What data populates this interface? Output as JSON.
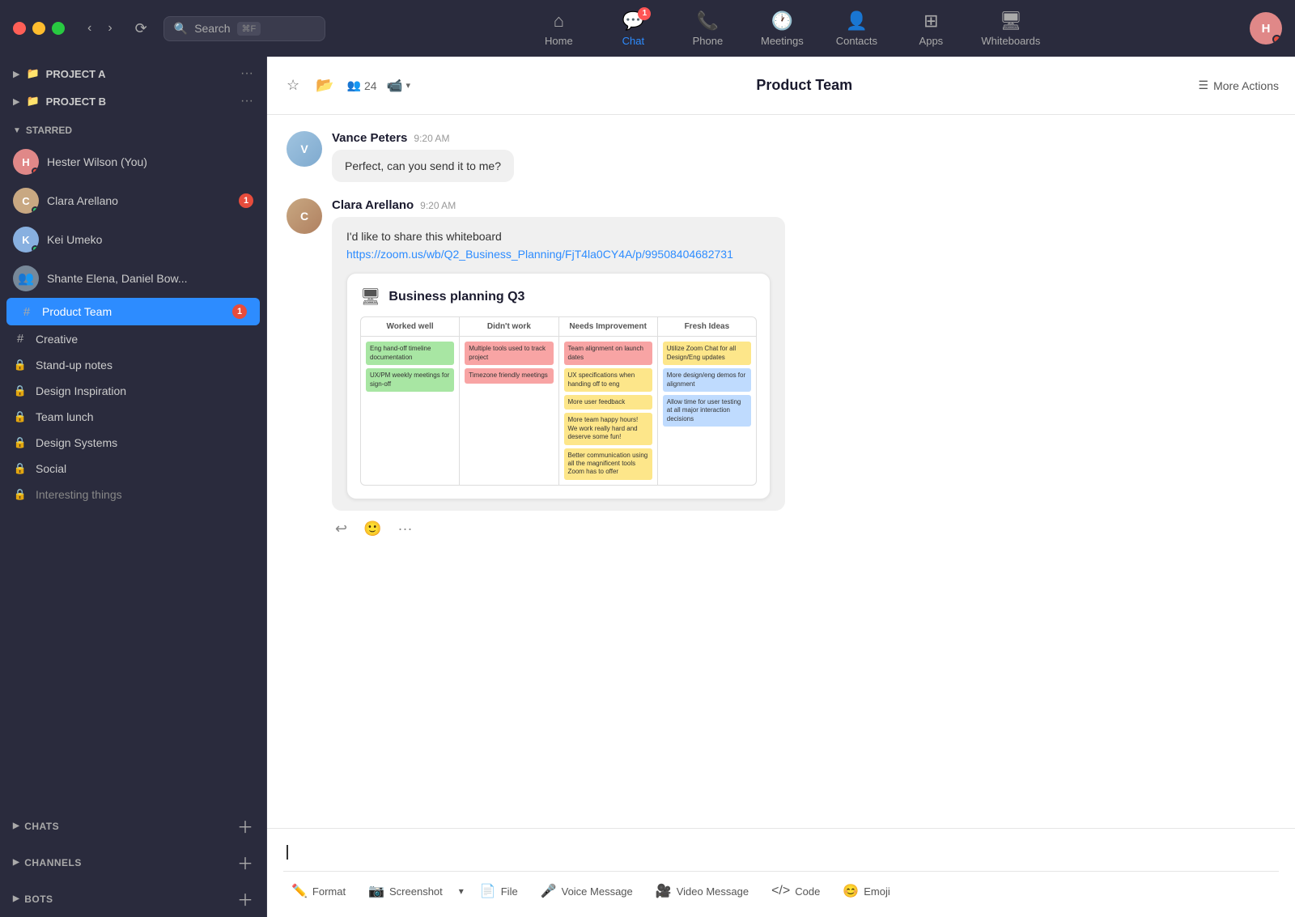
{
  "titlebar": {
    "search_placeholder": "Search",
    "search_shortcut": "⌘F",
    "history_icon": "⟲"
  },
  "nav": {
    "tabs": [
      {
        "id": "home",
        "label": "Home",
        "icon": "⌂",
        "active": false,
        "badge": null
      },
      {
        "id": "chat",
        "label": "Chat",
        "icon": "💬",
        "active": true,
        "badge": "1"
      },
      {
        "id": "phone",
        "label": "Phone",
        "icon": "📞",
        "active": false,
        "badge": null
      },
      {
        "id": "meetings",
        "label": "Meetings",
        "icon": "🕐",
        "active": false,
        "badge": null
      },
      {
        "id": "contacts",
        "label": "Contacts",
        "icon": "👤",
        "active": false,
        "badge": null
      },
      {
        "id": "apps",
        "label": "Apps",
        "icon": "⊞",
        "active": false,
        "badge": null
      },
      {
        "id": "whiteboards",
        "label": "Whiteboards",
        "icon": "🖥",
        "active": false,
        "badge": null
      }
    ]
  },
  "sidebar": {
    "folders": [
      {
        "id": "project-a",
        "label": "PROJECT A"
      },
      {
        "id": "project-b",
        "label": "PROJECT B"
      }
    ],
    "starred_label": "STARRED",
    "starred_items": [
      {
        "id": "hester",
        "label": "Hester Wilson (You)",
        "type": "avatar",
        "status": "red"
      },
      {
        "id": "clara",
        "label": "Clara Arellano",
        "type": "avatar",
        "status": "online",
        "unread": "1"
      },
      {
        "id": "kei",
        "label": "Kei Umeko",
        "type": "avatar",
        "status": "online"
      },
      {
        "id": "group",
        "label": "Shante Elena, Daniel Bow...",
        "type": "group"
      }
    ],
    "channels": [
      {
        "id": "product-team",
        "label": "Product Team",
        "type": "hash",
        "active": true,
        "unread": "1"
      },
      {
        "id": "creative",
        "label": "Creative",
        "type": "hash"
      },
      {
        "id": "standup",
        "label": "Stand-up notes",
        "type": "lock"
      },
      {
        "id": "design-inspo",
        "label": "Design Inspiration",
        "type": "lock"
      },
      {
        "id": "team-lunch",
        "label": "Team lunch",
        "type": "lock"
      },
      {
        "id": "design-sys",
        "label": "Design Systems",
        "type": "lock"
      },
      {
        "id": "social",
        "label": "Social",
        "type": "lock"
      },
      {
        "id": "interesting",
        "label": "Interesting things",
        "type": "lock"
      }
    ],
    "sections": [
      {
        "id": "chats",
        "label": "CHATS"
      },
      {
        "id": "channels",
        "label": "CHANNELS"
      },
      {
        "id": "bots",
        "label": "BOTS"
      }
    ]
  },
  "chat": {
    "title": "Product Team",
    "members_count": "24",
    "more_actions": "More Actions",
    "messages": [
      {
        "id": "msg1",
        "sender": "Vance Peters",
        "time": "9:20 AM",
        "type": "bubble",
        "text": "Perfect, can you send it to me?"
      },
      {
        "id": "msg2",
        "sender": "Clara Arellano",
        "time": "9:20 AM",
        "type": "whiteboard",
        "text": "I'd like to share this whiteboard",
        "link": "https://zoom.us/wb/Q2_Business_Planning/FjT4la0CY4A/p/99508404682731",
        "whiteboard": {
          "title": "Business planning Q3",
          "columns": [
            "Worked well",
            "Didn't work",
            "Needs Improvement",
            "Fresh Ideas"
          ],
          "col1_stickies": [
            {
              "color": "green",
              "text": "Eng hand-off timeline documentation"
            },
            {
              "color": "green",
              "text": "UX/PM weekly meetings for sign-off"
            }
          ],
          "col2_stickies": [
            {
              "color": "red",
              "text": "Multiple tools used to track project"
            },
            {
              "color": "red",
              "text": "Timezone friendly meetings"
            }
          ],
          "col3_stickies": [
            {
              "color": "red",
              "text": "Team alignment on launch dates"
            },
            {
              "color": "yellow",
              "text": "UX specifications when handing off to eng"
            },
            {
              "color": "yellow",
              "text": "More user feedback"
            },
            {
              "color": "yellow",
              "text": "More team happy hours! We work really hard and deserve some fun!"
            },
            {
              "color": "yellow",
              "text": "Better communication using all the magnificent tools Zoom has to offer"
            }
          ],
          "col4_stickies": [
            {
              "color": "yellow",
              "text": "Utilize Zoom Chat for all Design/Eng updates"
            },
            {
              "color": "blue",
              "text": "More design/eng demos for alignment"
            },
            {
              "color": "blue",
              "text": "Allow time for user testing at all major interaction decisions"
            }
          ]
        }
      }
    ],
    "actions": [
      {
        "id": "reply",
        "icon": "↩",
        "label": "Reply"
      },
      {
        "id": "emoji",
        "icon": "🙂",
        "label": "Emoji"
      },
      {
        "id": "more",
        "icon": "···",
        "label": "More"
      }
    ]
  },
  "toolbar": {
    "format_label": "Format",
    "screenshot_label": "Screenshot",
    "file_label": "File",
    "voice_label": "Voice Message",
    "video_label": "Video Message",
    "code_label": "Code",
    "emoji_label": "Emoji"
  }
}
